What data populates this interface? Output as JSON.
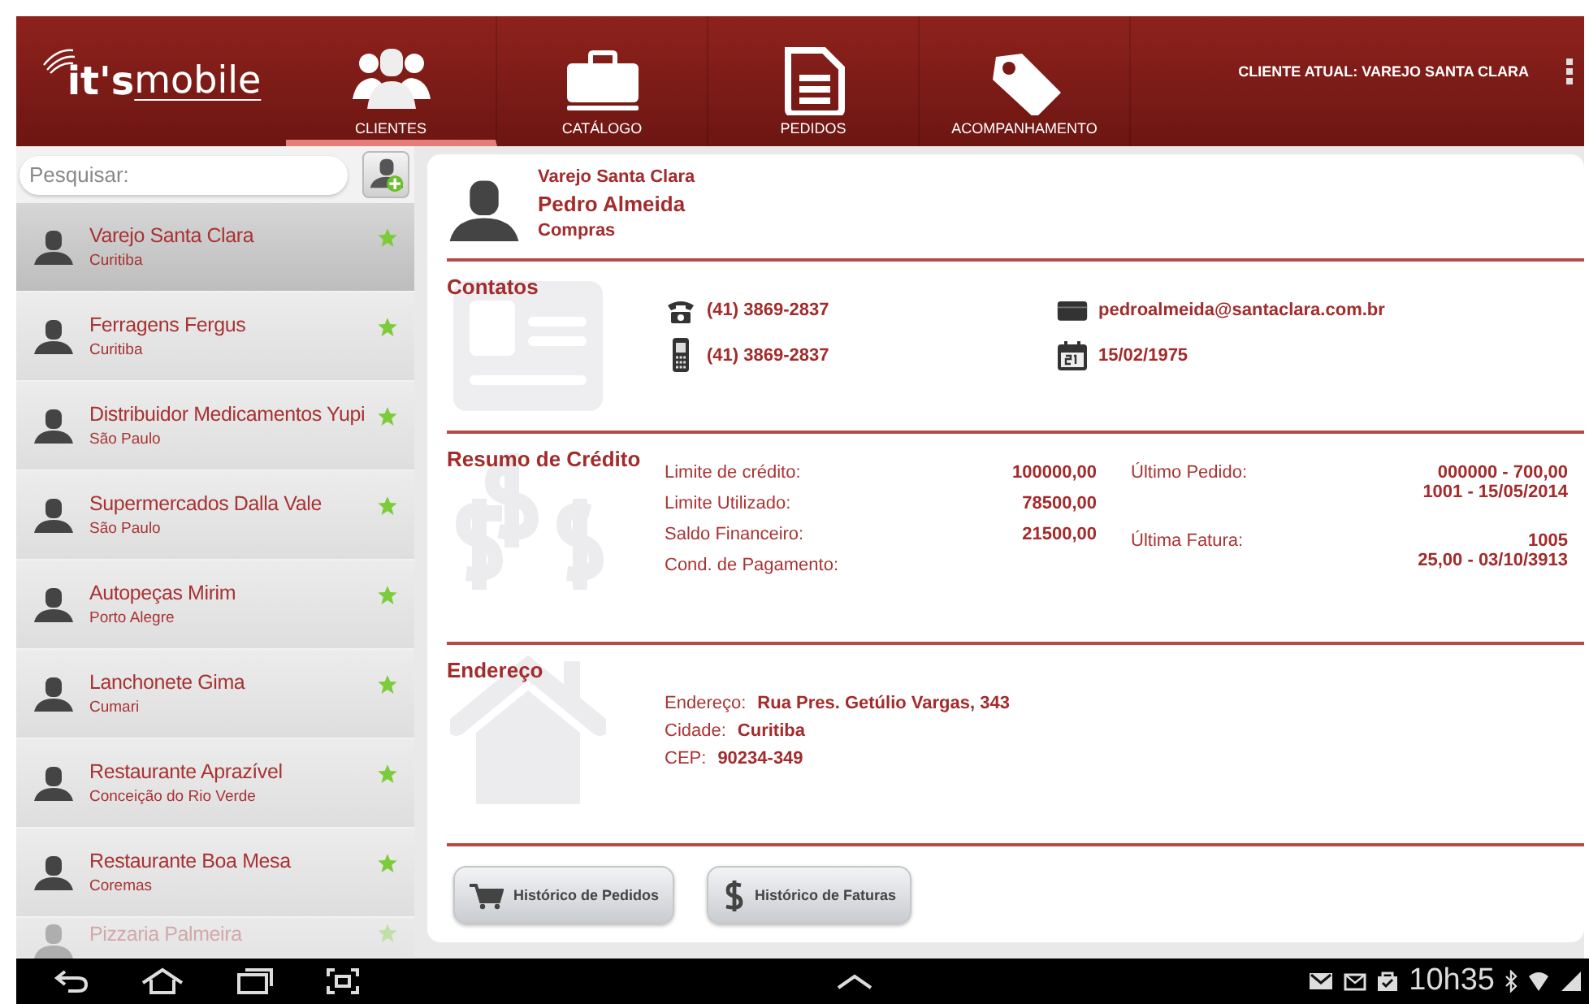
{
  "header": {
    "logo": {
      "brand": "it's",
      "suffix": "mobile"
    },
    "tabs": [
      {
        "label": "CLIENTES",
        "kind": "people",
        "selected": true
      },
      {
        "label": "CATÁLOGO",
        "kind": "briefcase",
        "selected": false
      },
      {
        "label": "PEDIDOS",
        "kind": "document",
        "selected": false
      },
      {
        "label": "ACOMPANHAMENTO",
        "kind": "tag",
        "selected": false
      }
    ],
    "current_client": "CLIENTE ATUAL: VAREJO SANTA CLARA"
  },
  "sidebar": {
    "search": {
      "placeholder": "Pesquisar:"
    },
    "clients": [
      {
        "name": "Varejo Santa Clara",
        "city": "Curitiba",
        "selected": true,
        "favorite": true
      },
      {
        "name": "Ferragens Fergus",
        "city": "Curitiba",
        "selected": false,
        "favorite": true
      },
      {
        "name": "Distribuidor Medicamentos Yupi",
        "city": "São Paulo",
        "selected": false,
        "favorite": true
      },
      {
        "name": "Supermercados Dalla Vale",
        "city": "São Paulo",
        "selected": false,
        "favorite": true
      },
      {
        "name": "Autopeças Mirim",
        "city": "Porto Alegre",
        "selected": false,
        "favorite": true
      },
      {
        "name": "Lanchonete Gima",
        "city": "Cumari",
        "selected": false,
        "favorite": true
      },
      {
        "name": "Restaurante Aprazível",
        "city": "Conceição do Rio Verde",
        "selected": false,
        "favorite": true
      },
      {
        "name": "Restaurante Boa Mesa",
        "city": "Coremas",
        "selected": false,
        "favorite": true
      },
      {
        "name": "Pizzaria Palmeira",
        "selected": false,
        "favorite": true
      }
    ]
  },
  "detail": {
    "company": "Varejo Santa Clara",
    "contact": "Pedro Almeida",
    "role": "Compras",
    "contacts": {
      "title": "Contatos",
      "items": [
        {
          "kind": "phone",
          "text": "(41) 3869-2837"
        },
        {
          "kind": "email",
          "text": "pedroalmeida@santaclara.com.br"
        },
        {
          "kind": "mobile",
          "text": "(41) 3869-2837"
        },
        {
          "kind": "calendar",
          "text": "15/02/1975"
        }
      ]
    },
    "credit": {
      "title": "Resumo de Crédito",
      "rows": [
        {
          "label": "Limite de crédito:",
          "value": "100000,00"
        },
        {
          "label": "Limite Utilizado:",
          "value": "78500,00"
        },
        {
          "label": "Saldo Financeiro:",
          "value": "21500,00"
        },
        {
          "label": "Cond. de Pagamento:"
        }
      ],
      "last": [
        {
          "label": "Último Pedido:",
          "lines": [
            "000000 - 700,00",
            "1001 - 15/05/2014"
          ]
        },
        {
          "label": "Última Fatura:",
          "lines": [
            "1005",
            "25,00 - 03/10/3913"
          ]
        }
      ]
    },
    "address": {
      "title": "Endereço",
      "rows": [
        {
          "label": "Endereço:",
          "value": "Rua Pres. Getúlio Vargas, 343"
        },
        {
          "label": "Cidade:",
          "value": "Curitiba"
        },
        {
          "label": "CEP:",
          "value": "90234-349"
        }
      ]
    },
    "buttons": [
      {
        "label": "Histórico de Pedidos",
        "kind": "cart"
      },
      {
        "label": "Histórico de Faturas",
        "kind": "dollar"
      }
    ]
  },
  "status_bar": {
    "time": "10h35"
  }
}
